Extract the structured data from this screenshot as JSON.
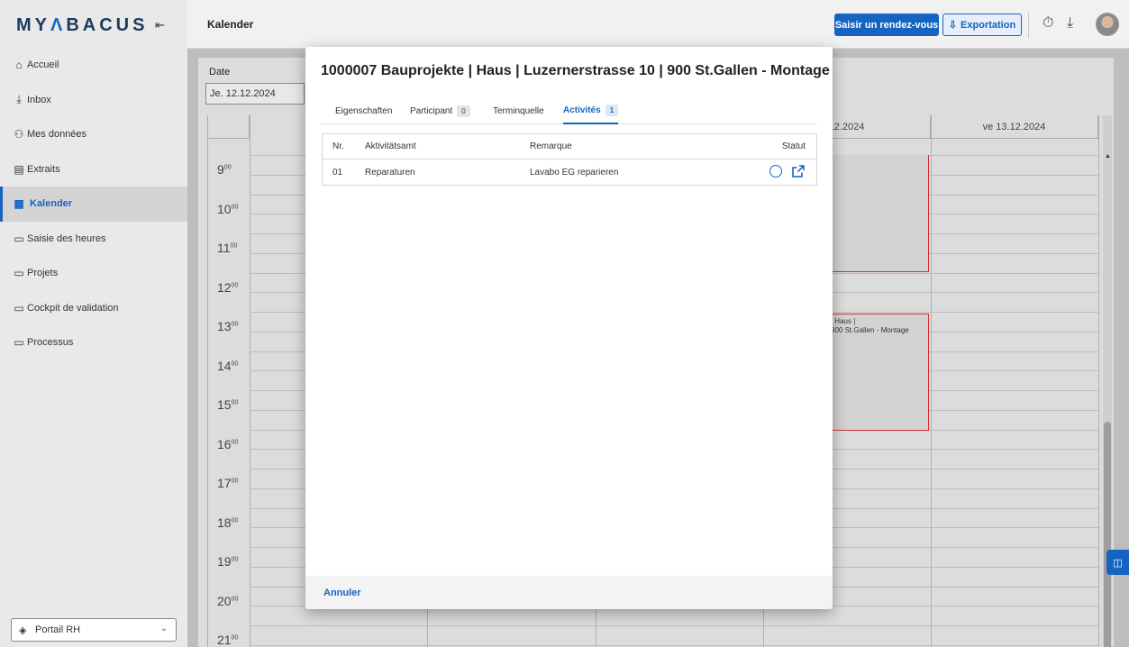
{
  "app": {
    "logo_text": "MYABACUS",
    "logo_parts": [
      "MY",
      "Λ",
      "BACUS"
    ],
    "page_title": "Kalender"
  },
  "sidebar": {
    "items": [
      {
        "label": "Accueil",
        "icon": "home-icon"
      },
      {
        "label": "Inbox",
        "icon": "inbox-icon"
      },
      {
        "label": "Mes données",
        "icon": "user-icon"
      },
      {
        "label": "Extraits",
        "icon": "document-icon"
      },
      {
        "label": "Kalender",
        "icon": "calendar-icon",
        "active": true
      },
      {
        "label": "Saisie des heures",
        "icon": "folder-icon"
      },
      {
        "label": "Projets",
        "icon": "folder-icon"
      },
      {
        "label": "Cockpit de validation",
        "icon": "folder-icon"
      },
      {
        "label": "Processus",
        "icon": "folder-icon"
      }
    ],
    "portal_label": "Portail RH"
  },
  "toolbar": {
    "primary_label": "Saisir un rendez-vous",
    "export_label": "Exportation"
  },
  "calendar": {
    "date_label": "Date",
    "date_value": "Je. 12.12.2024",
    "col_partial": "12.2024",
    "col_friday": "ve 13.12.2024",
    "hours": [
      "9",
      "10",
      "11",
      "12",
      "13",
      "14",
      "15",
      "16",
      "17",
      "18",
      "19",
      "20",
      "21"
    ],
    "event_line1": "| Haus |",
    "event_line2": "900 St.Gallen - Montage"
  },
  "dialog": {
    "title": "1000007 Bauprojekte | Haus | Luzernerstrasse 10 | 900 St.Gallen - Montage",
    "tabs": [
      {
        "label": "Eigenschaften",
        "badge": null
      },
      {
        "label": "Participant",
        "badge": "0"
      },
      {
        "label": "Terminquelle",
        "badge": null
      },
      {
        "label": "Activités",
        "badge": "1",
        "active": true
      }
    ],
    "table": {
      "headers": [
        "Nr.",
        "Aktivitätsamt",
        "Remarque",
        "Statut"
      ],
      "rows": [
        {
          "nr": "01",
          "activity": "Reparaturen",
          "remark": "Lavabo EG reparieren"
        }
      ]
    },
    "cancel_label": "Annuler"
  },
  "colors": {
    "accent": "#1565c0",
    "event_border": "#d32f2f"
  }
}
